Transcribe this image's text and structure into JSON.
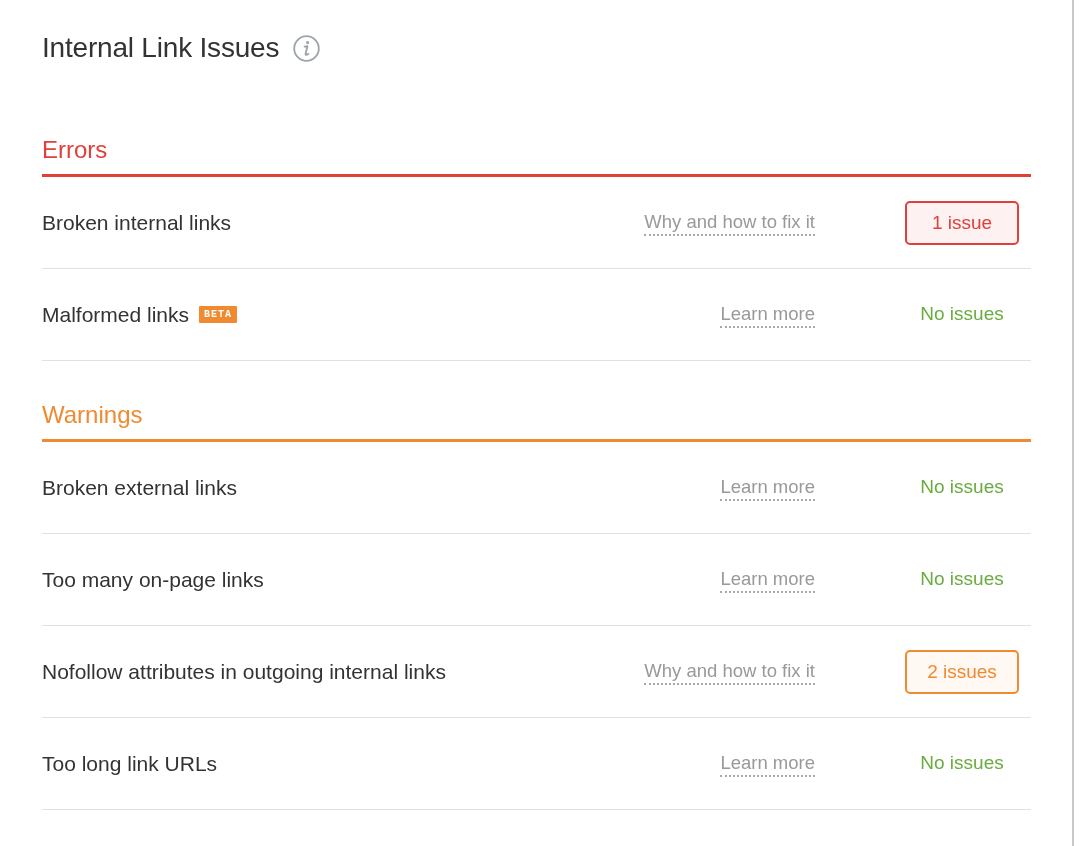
{
  "title": "Internal Link Issues",
  "sections": [
    {
      "kind": "error",
      "title": "Errors",
      "rows": [
        {
          "name": "Broken internal links",
          "link": "Why and how to fix it",
          "status": "1 issue",
          "has_issues": true
        },
        {
          "name": "Malformed links",
          "badge": "BETA",
          "link": "Learn more",
          "status": "No issues",
          "has_issues": false
        }
      ]
    },
    {
      "kind": "warning",
      "title": "Warnings",
      "rows": [
        {
          "name": "Broken external links",
          "link": "Learn more",
          "status": "No issues",
          "has_issues": false
        },
        {
          "name": "Too many on-page links",
          "link": "Learn more",
          "status": "No issues",
          "has_issues": false
        },
        {
          "name": "Nofollow attributes in outgoing internal links",
          "link": "Why and how to fix it",
          "status": "2 issues",
          "has_issues": true
        },
        {
          "name": "Too long link URLs",
          "link": "Learn more",
          "status": "No issues",
          "has_issues": false
        }
      ]
    }
  ]
}
